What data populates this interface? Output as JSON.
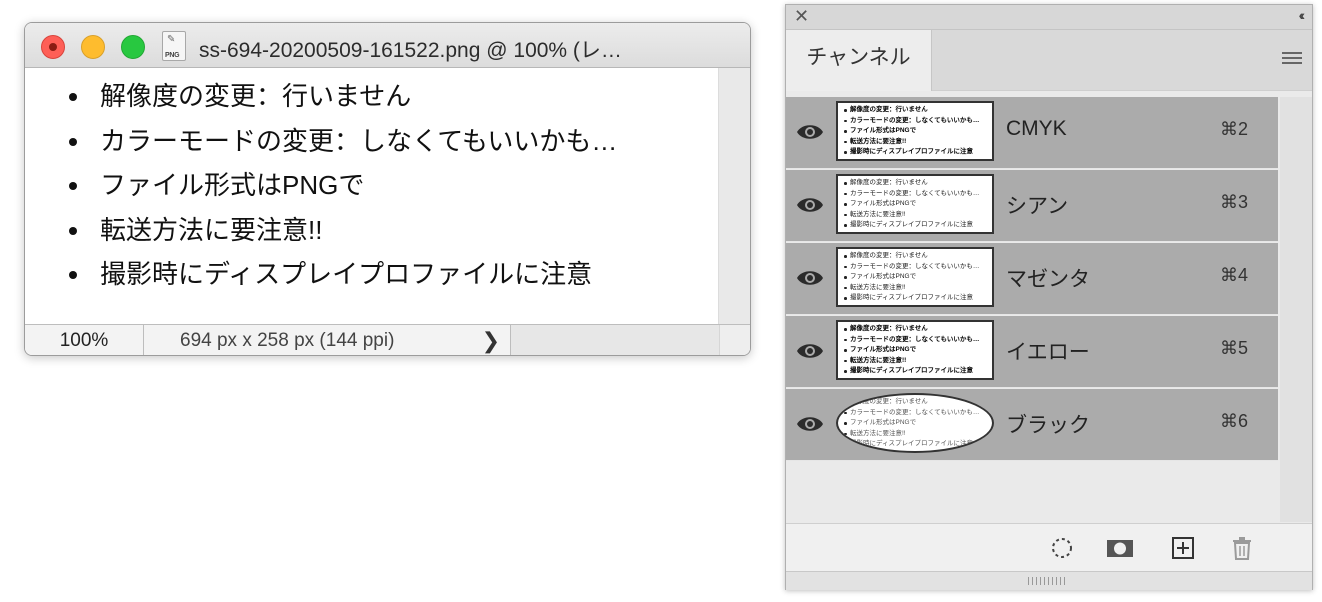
{
  "document_window": {
    "title": "ss-694-20200509-161522.png @ 100% (レ…",
    "file_icon_label": "PNG",
    "content_lines": [
      "解像度の変更：行いません",
      "カラーモードの変更：しなくてもいいかも…",
      "ファイル形式はPNGで",
      "転送方法に要注意!!",
      "撮影時にディスプレイプロファイルに注意"
    ],
    "status": {
      "zoom": "100%",
      "dimensions": "694 px x 258 px (144 ppi)",
      "arrow": "❯"
    }
  },
  "channels_panel": {
    "close_glyph": "✕",
    "collapse_glyph": "‹‹",
    "tab_label": "チャンネル",
    "channels": [
      {
        "name": "CMYK",
        "shortcut": "⌘2",
        "visible": true,
        "icon": "eye-icon"
      },
      {
        "name": "シアン",
        "shortcut": "⌘3",
        "visible": true,
        "icon": "eye-icon"
      },
      {
        "name": "マゼンタ",
        "shortcut": "⌘4",
        "visible": true,
        "icon": "eye-icon"
      },
      {
        "name": "イエロー",
        "shortcut": "⌘5",
        "visible": true,
        "icon": "eye-icon"
      },
      {
        "name": "ブラック",
        "shortcut": "⌘6",
        "visible": true,
        "icon": "eye-icon"
      }
    ],
    "thumbnail_lines": [
      "解像度の変更：行いません",
      "カラーモードの変更：しなくてもいいかも…",
      "ファイル形式はPNGで",
      "転送方法に要注意!!",
      "撮影時にディスプレイプロファイルに注意"
    ],
    "bottom_icons": [
      "selection-icon",
      "mask-icon",
      "new-channel-icon",
      "trash-icon"
    ]
  }
}
